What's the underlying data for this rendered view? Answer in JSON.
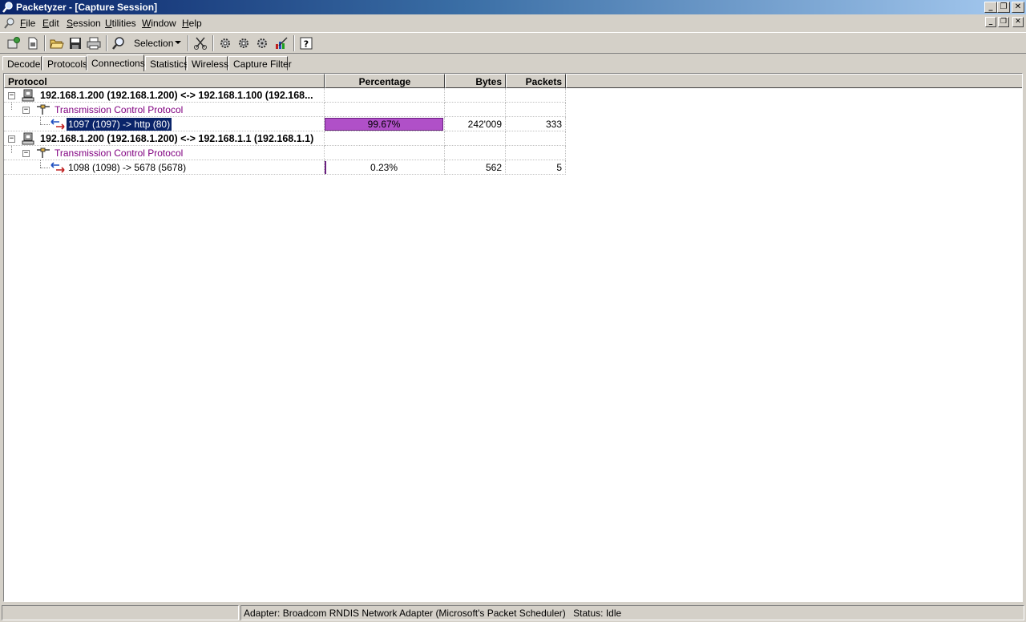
{
  "window": {
    "title": "Packetyzer - [Capture Session]"
  },
  "menu": [
    "File",
    "Edit",
    "Session",
    "Utilities",
    "Window",
    "Help"
  ],
  "toolbar": {
    "selection_label": "Selection"
  },
  "tabs": [
    "Decode",
    "Protocols",
    "Connections",
    "Statistics",
    "Wireless",
    "Capture Filter"
  ],
  "active_tab": "Connections",
  "columns": {
    "protocol": "Protocol",
    "percentage": "Percentage",
    "bytes": "Bytes",
    "packets": "Packets"
  },
  "rows": [
    {
      "kind": "host",
      "label": "192.168.1.200 (192.168.1.200) <-> 192.168.1.100 (192.168...",
      "expanded": true
    },
    {
      "kind": "protocol",
      "label": "Transmission Control Protocol",
      "expanded": true
    },
    {
      "kind": "connection",
      "label": "1097 (1097) -> http (80)",
      "selected": true,
      "percentage": "99.67%",
      "percentage_value": 99.67,
      "bytes": "242'009",
      "packets": "333"
    },
    {
      "kind": "host",
      "label": "192.168.1.200 (192.168.1.200) <-> 192.168.1.1 (192.168.1.1)",
      "expanded": true
    },
    {
      "kind": "protocol",
      "label": "Transmission Control Protocol",
      "expanded": true
    },
    {
      "kind": "connection",
      "label": "1098 (1098) -> 5678 (5678)",
      "selected": false,
      "percentage": "0.23%",
      "percentage_value": 0.23,
      "bytes": "562",
      "packets": "5"
    }
  ],
  "colors": {
    "bar": "#b050c8",
    "protocol_text": "#800080",
    "selection": "#0a246a"
  },
  "status": {
    "adapter": "Adapter: Broadcom RNDIS Network Adapter (Microsoft's Packet Scheduler)",
    "state": "Status: Idle"
  }
}
